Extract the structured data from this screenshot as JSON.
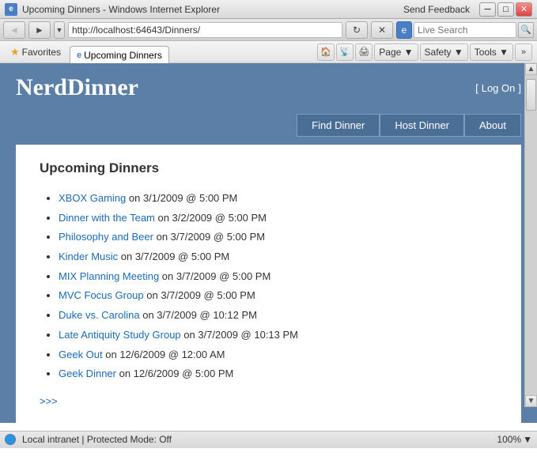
{
  "titleBar": {
    "icon": "e",
    "title": "Upcoming Dinners - Windows Internet Explorer",
    "sendFeedback": "Send Feedback",
    "minimize": "─",
    "restore": "□",
    "close": "✕"
  },
  "addressBar": {
    "back": "◄",
    "forward": "►",
    "refresh": "↻",
    "stop": "✕",
    "url": "http://localhost:64643/Dinners/",
    "searchPlaceholder": "Live Search",
    "searchIcon": "🔍"
  },
  "toolbar": {
    "favoritesLabel": "Favorites",
    "tabLabel": "Upcoming Dinners",
    "pageLabel": "Page ▼",
    "safetyLabel": "Safety ▼",
    "toolsLabel": "Tools ▼"
  },
  "header": {
    "siteTitle": "NerdDinner",
    "logonBracketLeft": "[ ",
    "logonLink": "Log On",
    "logonBracketRight": " ]"
  },
  "nav": {
    "findDinner": "Find Dinner",
    "hostDinner": "Host Dinner",
    "about": "About"
  },
  "main": {
    "sectionTitle": "Upcoming Dinners",
    "dinners": [
      {
        "name": "XBOX Gaming",
        "detail": " on 3/1/2009 @ 5:00 PM"
      },
      {
        "name": "Dinner with the Team",
        "detail": " on 3/2/2009 @ 5:00 PM"
      },
      {
        "name": "Philosophy and Beer",
        "detail": " on 3/7/2009 @ 5:00 PM"
      },
      {
        "name": "Kinder Music",
        "detail": " on 3/7/2009 @ 5:00 PM"
      },
      {
        "name": "MIX Planning Meeting",
        "detail": " on 3/7/2009 @ 5:00 PM"
      },
      {
        "name": "MVC Focus Group",
        "detail": " on 3/7/2009 @ 5:00 PM"
      },
      {
        "name": "Duke vs. Carolina",
        "detail": " on 3/7/2009 @ 10:12 PM"
      },
      {
        "name": "Late Antiquity Study Group",
        "detail": " on 3/7/2009 @ 10:13 PM"
      },
      {
        "name": "Geek Out",
        "detail": " on 12/6/2009 @ 12:00 AM"
      },
      {
        "name": "Geek Dinner",
        "detail": " on 12/6/2009 @ 5:00 PM"
      }
    ],
    "moreLink": ">>>"
  },
  "statusBar": {
    "status": "Local intranet | Protected Mode: Off",
    "zoom": "100%"
  }
}
